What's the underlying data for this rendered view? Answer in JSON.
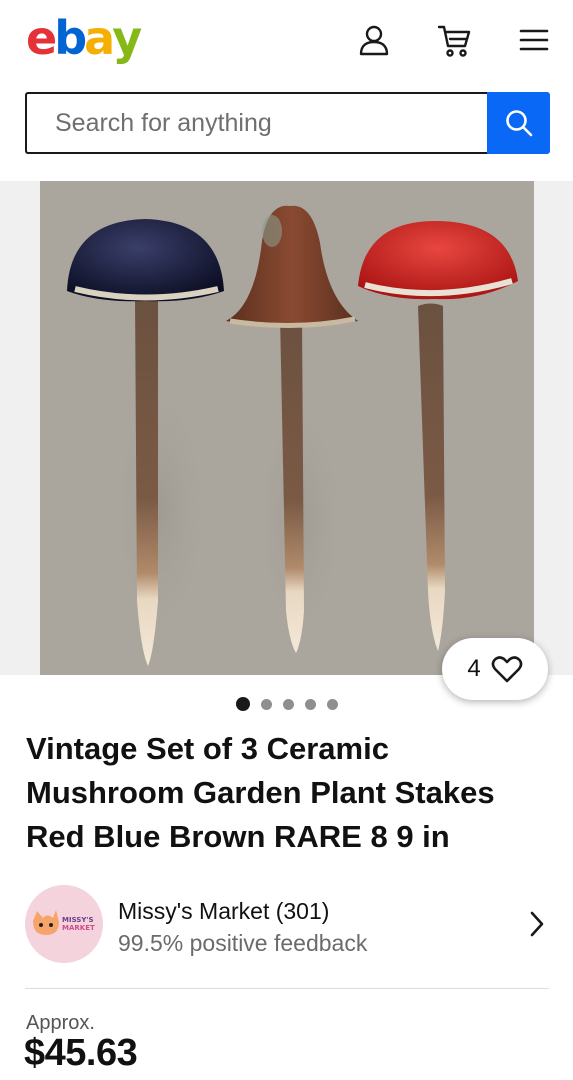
{
  "header": {
    "logo_letters": [
      "e",
      "b",
      "a",
      "y"
    ],
    "logo_colors": [
      "#e53238",
      "#0064d2",
      "#f5af02",
      "#86b817"
    ],
    "icons": [
      "account-icon",
      "cart-icon",
      "menu-icon"
    ]
  },
  "search": {
    "placeholder": "Search for anything",
    "button_icon": "search-icon",
    "button_color": "#0968f6"
  },
  "gallery": {
    "watch_count": "4",
    "image_count": 5,
    "active_index": 0
  },
  "listing": {
    "title": "Vintage Set of 3 Ceramic Mushroom Garden Plant Stakes Red Blue Brown RARE 8 9 in"
  },
  "seller": {
    "name": "Missy's Market (301)",
    "feedback": "99.5% positive feedback",
    "avatar_text": "MISSY'S MARKET"
  },
  "price": {
    "prefix": "Approx.",
    "value": "$45.63"
  }
}
